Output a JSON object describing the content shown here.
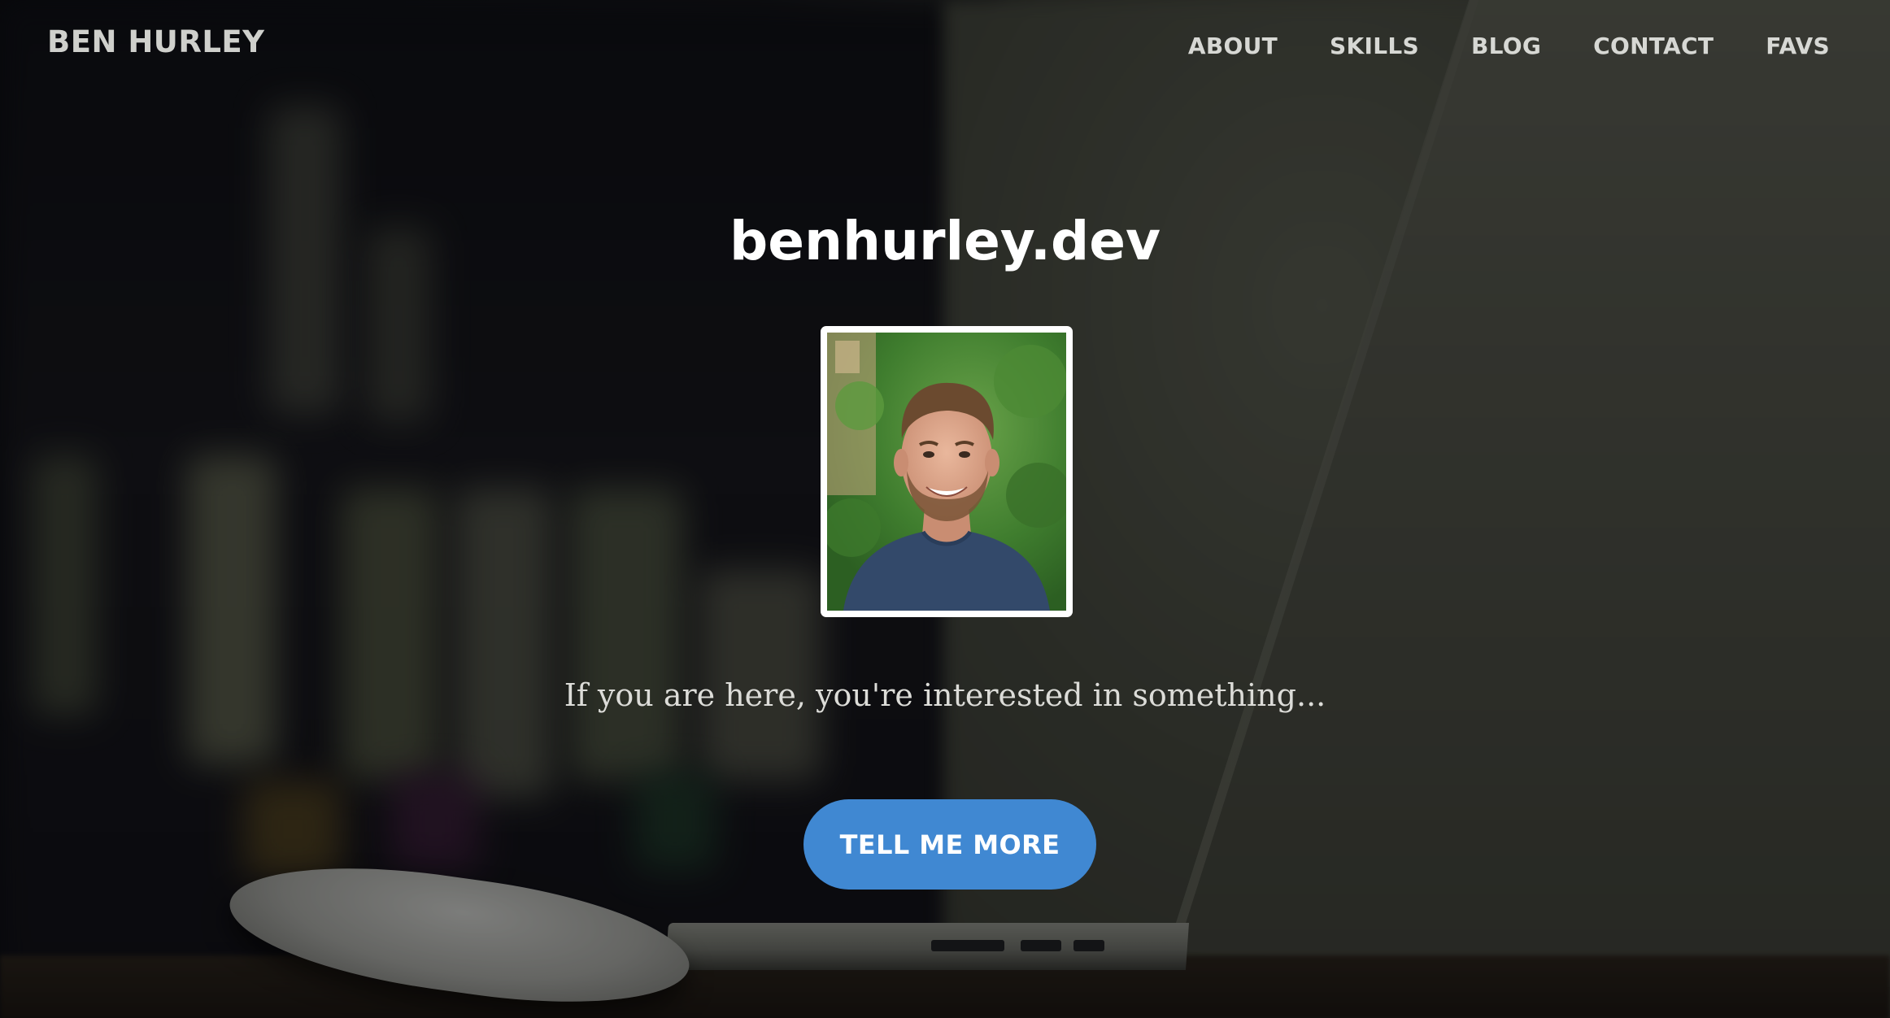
{
  "nav": {
    "brand": "BEN HURLEY",
    "items": [
      {
        "label": "ABOUT"
      },
      {
        "label": "SKILLS"
      },
      {
        "label": "BLOG"
      },
      {
        "label": "CONTACT"
      },
      {
        "label": "FAVS"
      }
    ]
  },
  "hero": {
    "title": "benhurley.dev",
    "tagline": "If you are here, you're interested in something...",
    "cta_label": "TELL ME MORE",
    "portrait_icon": "profile-photo"
  },
  "colors": {
    "accent": "#4088d2",
    "nav_text": "#d7d8d4",
    "title_text": "#ffffff"
  }
}
